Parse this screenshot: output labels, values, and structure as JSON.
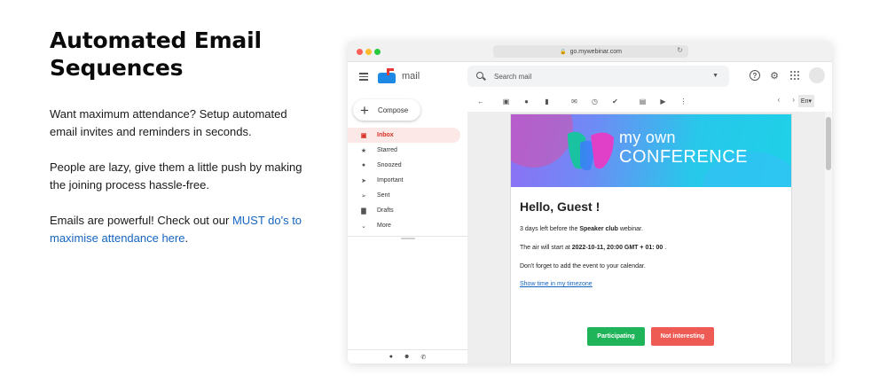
{
  "copy": {
    "heading_line1": "Automated Email",
    "heading_line2": "Sequences",
    "p1": "Want maximum attendance? Setup automated email invites and reminders in seconds.",
    "p2": "People are lazy, give them a little push by making the joining process hassle-free.",
    "p3_prefix": "Emails are powerful! Check out our ",
    "p3_link": "MUST do's to maximise attendance here",
    "p3_suffix": "."
  },
  "browser": {
    "url": "go.mywebinar.com"
  },
  "gmail": {
    "app_name": "mail",
    "search_placeholder": "Search mail",
    "compose_label": "Compose",
    "nav": [
      {
        "label": "Inbox",
        "icon": "inbox-icon",
        "active": true
      },
      {
        "label": "Starred",
        "icon": "star-icon"
      },
      {
        "label": "Snoozed",
        "icon": "clock-icon"
      },
      {
        "label": "Important",
        "icon": "important-icon"
      },
      {
        "label": "Sent",
        "icon": "send-icon"
      },
      {
        "label": "Drafts",
        "icon": "draft-icon"
      },
      {
        "label": "More",
        "icon": "chevron-down-icon"
      }
    ],
    "language": "En"
  },
  "email": {
    "banner_line1": "my own",
    "banner_line2": "CONFERENCE",
    "greeting": "Hello, Guest !",
    "line1_prefix": "3 days left before the ",
    "line1_bold": "Speaker club",
    "line1_suffix": " webinar.",
    "line2_prefix": "The air will start at ",
    "line2_bold": "2022-10-11, 20:00 GMT + 01: 00",
    "line2_suffix": " .",
    "line3": "Don't forget to add the event to your calendar.",
    "timezone_link": "Show time in my timezone",
    "btn_yes": "Participating",
    "btn_no": "Not interesting"
  },
  "colors": {
    "accent_link": "#1565c0",
    "inbox_active": "#d93025",
    "participate_green": "#20b45a",
    "decline_red": "#ee5a54"
  }
}
